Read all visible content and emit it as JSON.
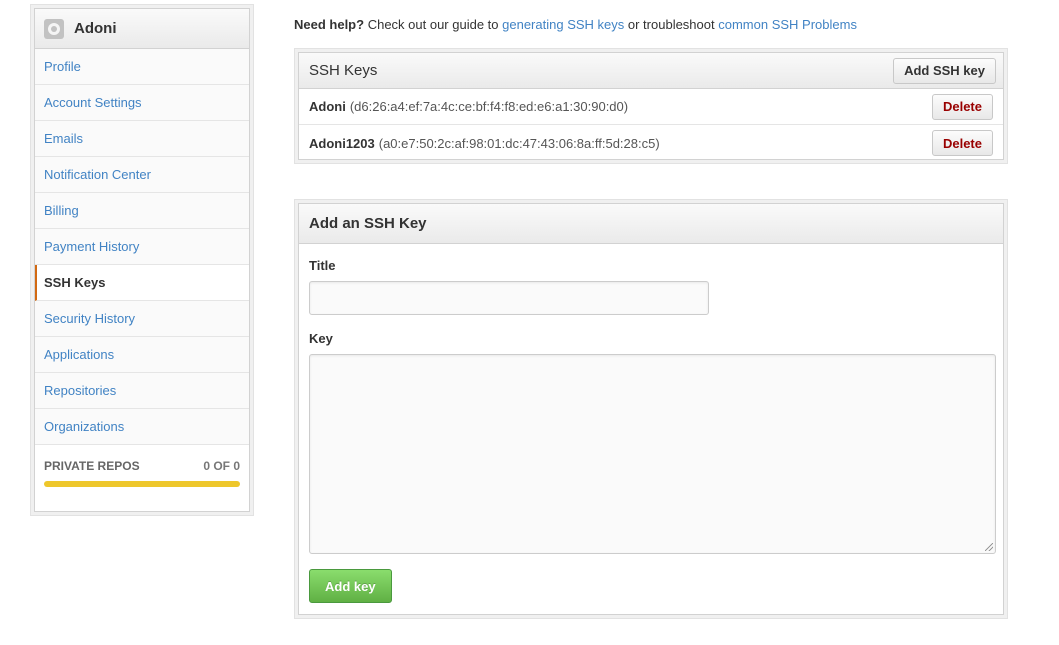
{
  "sidebar": {
    "username": "Adoni",
    "avatar_icon": "octocat-icon",
    "items": [
      {
        "label": "Profile",
        "selected": false
      },
      {
        "label": "Account Settings",
        "selected": false
      },
      {
        "label": "Emails",
        "selected": false
      },
      {
        "label": "Notification Center",
        "selected": false
      },
      {
        "label": "Billing",
        "selected": false
      },
      {
        "label": "Payment History",
        "selected": false
      },
      {
        "label": "SSH Keys",
        "selected": true
      },
      {
        "label": "Security History",
        "selected": false
      },
      {
        "label": "Applications",
        "selected": false
      },
      {
        "label": "Repositories",
        "selected": false
      },
      {
        "label": "Organizations",
        "selected": false
      }
    ],
    "private_repos": {
      "label": "PRIVATE REPOS",
      "value": "0 OF 0",
      "used_fraction": 0,
      "bar_color": "#eec72b"
    }
  },
  "help": {
    "bold": "Need help?",
    "text1": "Check out our guide to",
    "link1": "generating SSH keys",
    "text2": "or troubleshoot",
    "link2": "common SSH Problems"
  },
  "ssh_keys": {
    "title": "SSH Keys",
    "add_button": "Add SSH key",
    "keys": [
      {
        "name": "Adoni",
        "fingerprint": "(d6:26:a4:ef:7a:4c:ce:bf:f4:f8:ed:e6:a1:30:90:d0)",
        "delete_label": "Delete"
      },
      {
        "name": "Adoni1203",
        "fingerprint": "(a0:e7:50:2c:af:98:01:dc:47:43:06:8a:ff:5d:28:c5)",
        "delete_label": "Delete"
      }
    ]
  },
  "add_key": {
    "title": "Add an SSH Key",
    "title_label": "Title",
    "title_value": "",
    "key_label": "Key",
    "key_value": "",
    "submit_label": "Add key"
  },
  "colors": {
    "link": "#4183c4",
    "accent_selected": "#d26911",
    "danger": "#990000",
    "primary_button": "#60b044"
  }
}
